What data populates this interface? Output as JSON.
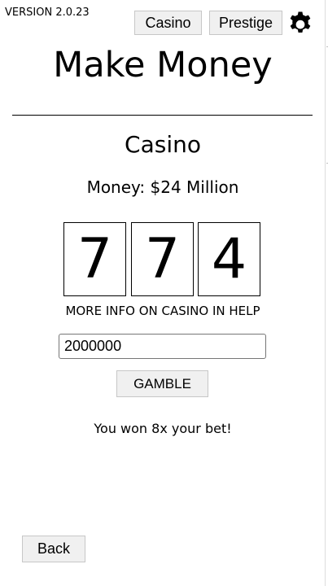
{
  "header": {
    "version": "VERSION 2.0.23",
    "nav": {
      "casino_label": "Casino",
      "prestige_label": "Prestige"
    },
    "settings_icon": "gear-icon"
  },
  "title": "Make Money",
  "casino": {
    "section_title": "Casino",
    "money_text": "Money: $24 Million",
    "slots": [
      "7",
      "7",
      "4"
    ],
    "help_text": "MORE INFO ON CASINO IN HELP",
    "bet_value": "2000000",
    "gamble_label": "GAMBLE",
    "result_text": "You won 8x your bet!"
  },
  "footer": {
    "back_label": "Back"
  },
  "colors": {
    "text": "#000000",
    "background": "#ffffff",
    "button_bg": "#f0f0f0",
    "button_border": "#c7c7c7"
  }
}
